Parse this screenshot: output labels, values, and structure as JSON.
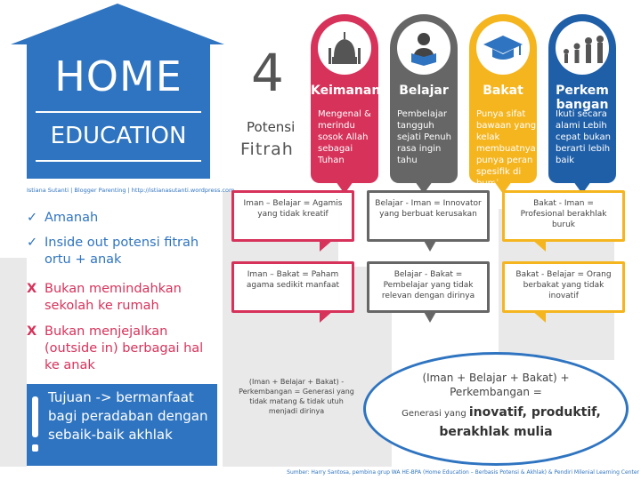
{
  "house": {
    "title": "HOME",
    "subtitle": "EDUCATION",
    "credit": "Istiana Sutanti | Blogger Parenting | http://istianasutanti.wordpress.com"
  },
  "points": [
    {
      "mark": "✓",
      "text": "Amanah"
    },
    {
      "mark": "✓",
      "text": "Inside out potensi fitrah  ortu + anak"
    },
    {
      "mark": "X",
      "text": "Bukan memindahkan sekolah ke rumah"
    },
    {
      "mark": "X",
      "text": "Bukan menjejalkan (outside in) berbagai hal ke anak"
    }
  ],
  "goal": {
    "text": "Tujuan -> bermanfaat bagi peradaban dengan sebaik-baik akhlak"
  },
  "header": {
    "number": "4",
    "line1": "Potensi",
    "line2": "Fitrah"
  },
  "colors": {
    "blue": "#2f74c0",
    "red": "#d6325a",
    "grey": "#666666",
    "yellow": "#f5b51f",
    "navy": "#1f5fa8"
  },
  "pins": [
    {
      "title": "Keimanan",
      "body": "Mengenal & merindu sosok Allah sebagai Tuhan",
      "icon": "mosque-icon",
      "color": "#d6325a"
    },
    {
      "title": "Belajar",
      "body": "Pembelajar tangguh sejati Penuh rasa ingin tahu",
      "icon": "reading-person-icon",
      "color": "#666666"
    },
    {
      "title": "Bakat",
      "body": "Punya sifat bawaan yang kelak membuatnya punya peran spesifik di bumi",
      "icon": "graduation-cap-icon",
      "color": "#f5b51f"
    },
    {
      "title": "Perkem bangan",
      "body": "Ikuti secara alami Lebih cepat bukan berarti lebih baik",
      "icon": "human-growth-icon",
      "color": "#1f5fa8"
    }
  ],
  "relations": [
    {
      "text": "Iman – Belajar = Agamis yang tidak kreatif",
      "color": "#d6325a"
    },
    {
      "text": "Belajar - Iman = Innovator yang berbuat kerusakan",
      "color": "#666666"
    },
    {
      "text": "Bakat - Iman = Profesional berakhlak buruk",
      "color": "#f5b51f"
    },
    {
      "text": "Iman – Bakat = Paham agama sedikit manfaat",
      "color": "#d6325a"
    },
    {
      "text": "Belajar - Bakat = Pembelajar yang tidak relevan dengan dirinya",
      "color": "#666666"
    },
    {
      "text": "Bakat - Belajar = Orang berbakat yang tidak inovatif",
      "color": "#f5b51f"
    }
  ],
  "perkembangan_note": "(Iman + Belajar + Bakat) - Perkembangan = Generasi yang tidak matang & tidak utuh menjadi dirinya",
  "summary": {
    "line1": "(Iman + Belajar + Bakat) +",
    "line2": "Perkembangan =",
    "line3_prefix": "Generasi yang",
    "line3_bold": "inovatif, produktif,",
    "line4": "berakhlak mulia"
  },
  "source": "Sumber: Harry Santosa, pembina grup WA HE-BPA (Home Education – Berbasis Potensi & Akhlak) & Pendiri Milenial Learning Center"
}
